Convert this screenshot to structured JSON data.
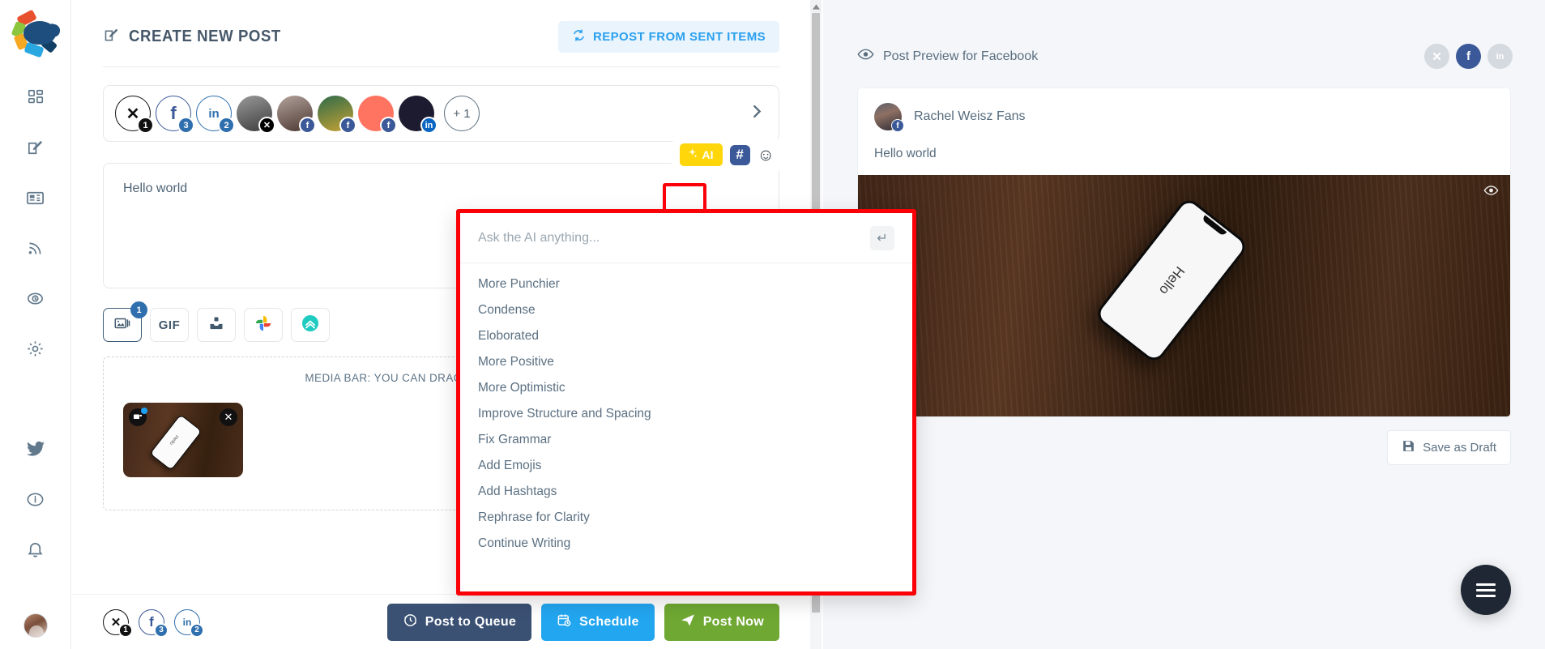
{
  "sidebar": {
    "logo_name": "app-logo",
    "items": [
      {
        "name": "dashboard",
        "icon": "grid-icon"
      },
      {
        "name": "compose",
        "icon": "edit-square-icon"
      },
      {
        "name": "content",
        "icon": "newspaper-icon"
      },
      {
        "name": "feeds",
        "icon": "rss-icon"
      },
      {
        "name": "queue",
        "icon": "history-clock-icon"
      },
      {
        "name": "settings",
        "icon": "gear-icon"
      },
      {
        "name": "twitter",
        "icon": "twitter-bird-icon"
      },
      {
        "name": "info",
        "icon": "info-circle-icon"
      },
      {
        "name": "notifications",
        "icon": "bell-icon"
      }
    ]
  },
  "composer": {
    "title": "CREATE NEW POST",
    "title_icon": "edit-square-icon",
    "repost_label": "REPOST FROM SENT ITEMS",
    "repost_icon": "refresh-cycle-icon",
    "accounts": [
      {
        "type": "x",
        "badge": "1",
        "badge_kind": "nblack",
        "kind": "ring",
        "glyph": "✕",
        "color": "#111111"
      },
      {
        "type": "facebook",
        "badge": "3",
        "badge_kind": "n",
        "kind": "ring",
        "glyph": "f",
        "color": "#3b5998"
      },
      {
        "type": "linkedin",
        "badge": "2",
        "badge_kind": "n",
        "kind": "ring",
        "glyph": "in",
        "color": "#2f6fad"
      },
      {
        "type": "avatar-bw",
        "badge": "x",
        "badge_kind": "x",
        "kind": "photo",
        "glyph": "𝕏"
      },
      {
        "type": "avatar-woman",
        "badge": "f",
        "badge_kind": "fb",
        "kind": "photo",
        "glyph": "f"
      },
      {
        "type": "avatar-sports",
        "badge": "f",
        "badge_kind": "fb",
        "kind": "photo",
        "glyph": "f"
      },
      {
        "type": "avatar-coral",
        "badge": "f",
        "badge_kind": "fb",
        "kind": "photo",
        "glyph": "f"
      },
      {
        "type": "avatar-marketer",
        "badge": "in",
        "badge_kind": "li",
        "kind": "photo",
        "glyph": "in"
      }
    ],
    "more_accounts_label": "+ 1",
    "next_icon": "chevron-right-icon",
    "editor_text": "Hello world",
    "tools": {
      "ai_label": "AI",
      "ai_icon": "sparkle-icon",
      "hashtag_icon": "hashtag-icon",
      "emoji_icon": "smiley-icon"
    },
    "media_tools": [
      {
        "name": "image",
        "icon": "image-stack-icon",
        "badge": "1",
        "active": true
      },
      {
        "name": "gif",
        "icon": "gif-text",
        "label": "GIF",
        "active": false
      },
      {
        "name": "upload",
        "icon": "upload-tray-icon",
        "active": false
      },
      {
        "name": "google-photos",
        "icon": "google-photos-icon",
        "active": false
      },
      {
        "name": "cloud-upload",
        "icon": "teal-up-arrow-icon",
        "active": false
      }
    ],
    "media_bar_label": "MEDIA BAR: YOU CAN DRAG-N-DROP IMAGE, GIF",
    "thumbnail": {
      "edit_icon": "image-edit-icon",
      "close_icon": "close-icon",
      "phone_label": "Hello"
    }
  },
  "bottom": {
    "socials": [
      {
        "type": "x",
        "glyph": "✕",
        "count": "1",
        "color": "#111111",
        "badge_kind": "nblack"
      },
      {
        "type": "facebook",
        "glyph": "f",
        "count": "3",
        "color": "#3b5998",
        "badge_kind": "n"
      },
      {
        "type": "linkedin",
        "glyph": "in",
        "count": "2",
        "color": "#2f6fad",
        "badge_kind": "n"
      }
    ],
    "actions": [
      {
        "name": "post-to-queue",
        "label": "Post to Queue",
        "icon": "queue-clock-icon",
        "color": "#3b5174"
      },
      {
        "name": "schedule",
        "label": "Schedule",
        "icon": "calendar-clock-icon",
        "color": "#23a6f0"
      },
      {
        "name": "post-now",
        "label": "Post Now",
        "icon": "paper-plane-icon",
        "color": "#6fa832"
      }
    ]
  },
  "preview": {
    "header_label": "Post Preview for Facebook",
    "header_icon": "eye-icon",
    "toggles": [
      {
        "name": "x",
        "glyph": "𝕏",
        "active": false
      },
      {
        "name": "facebook",
        "glyph": "f",
        "active": true
      },
      {
        "name": "linkedin",
        "glyph": "in",
        "active": false
      }
    ],
    "account_name": "Rachel Weisz Fans",
    "account_badge": "f",
    "post_text": "Hello world",
    "image_phone_text": "Hello",
    "image_eye_icon": "eye-icon",
    "save_draft_label": "Save as Draft",
    "save_draft_icon": "floppy-disk-icon"
  },
  "ai_panel": {
    "placeholder": "Ask the AI anything...",
    "value": "",
    "enter_icon": "enter-arrow-icon",
    "options": [
      "More Punchier",
      "Condense",
      "Eloborated",
      "More Positive",
      "More Optimistic",
      "Improve Structure and Spacing",
      "Fix Grammar",
      "Add Emojis",
      "Add Hashtags",
      "Rephrase for Clarity",
      "Continue Writing"
    ]
  },
  "fab": {
    "name": "menu-fab",
    "icon": "hamburger-icon"
  },
  "colors": {
    "highlight": "#fb0007",
    "ai_yellow": "#ffd60a",
    "accent_blue": "#2ba0ef"
  }
}
